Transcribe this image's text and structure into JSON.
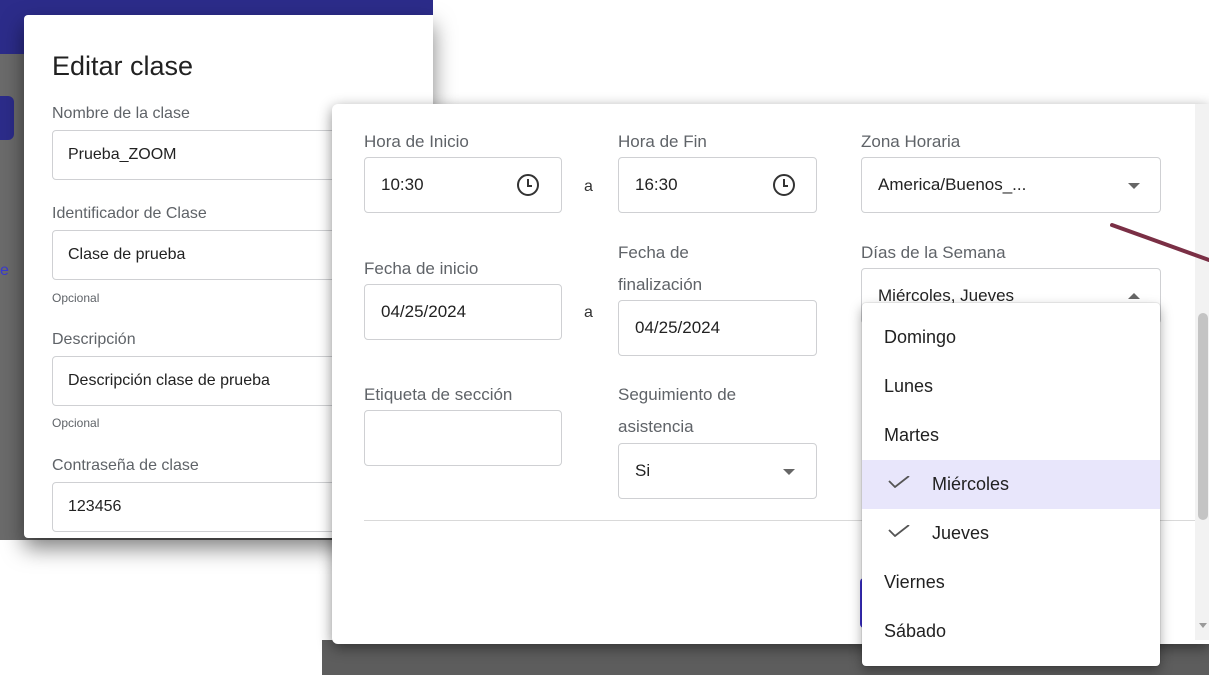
{
  "edit_dialog": {
    "title": "Editar clase",
    "class_name_label": "Nombre de la clase",
    "class_name_value": "Prueba_ZOOM",
    "class_id_label": "Identificador de Clase",
    "class_id_value": "Clase de prueba",
    "class_id_hint": "Opcional",
    "description_label": "Descripción",
    "description_value": "Descripción clase de prueba",
    "description_hint": "Opcional",
    "password_label": "Contraseña de clase",
    "password_value": "123456"
  },
  "background": {
    "tab_fragment": "e"
  },
  "schedule": {
    "start_time_label": "Hora de Inicio",
    "start_time_value": "10:30",
    "to_separator": "a",
    "end_time_label": "Hora de Fin",
    "end_time_value": "16:30",
    "timezone_label": "Zona Horaria",
    "timezone_value": "America/Buenos_...",
    "start_date_label": "Fecha de inicio",
    "start_date_value": "04/25/2024",
    "end_date_label_line1": "Fecha de",
    "end_date_label_line2": "finalización",
    "end_date_value": "04/25/2024",
    "weekdays_label": "Días de la Semana",
    "weekdays_value": "Miércoles, Jueves",
    "section_label": "Etiqueta de sección",
    "section_value": "",
    "attendance_label_line1": "Seguimiento de",
    "attendance_label_line2": "asistencia",
    "attendance_value": "Si"
  },
  "day_menu": {
    "items": [
      {
        "label": "Domingo",
        "checked": false
      },
      {
        "label": "Lunes",
        "checked": false
      },
      {
        "label": "Martes",
        "checked": false
      },
      {
        "label": "Miércoles",
        "checked": true,
        "highlighted": true
      },
      {
        "label": "Jueves",
        "checked": true
      },
      {
        "label": "Viernes",
        "checked": false
      },
      {
        "label": "Sábado",
        "checked": false
      }
    ]
  },
  "colors": {
    "primary": "#3b2fc9",
    "header": "#2c2c8a",
    "selected_bg": "#e8e6fb",
    "arrow": "#7a2f45"
  }
}
